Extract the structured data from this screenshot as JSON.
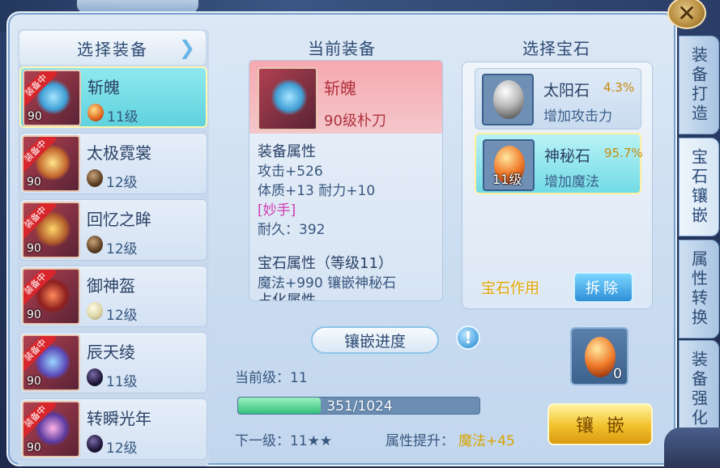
{
  "left": {
    "header": "选择装备",
    "items": [
      {
        "name": "斩魄",
        "level": "90",
        "tag": "装备中",
        "gem_level": "11级",
        "gem": "gem-orange"
      },
      {
        "name": "太极霓裳",
        "level": "90",
        "tag": "装备中",
        "gem_level": "12级",
        "gem": "gem-brown"
      },
      {
        "name": "回忆之眸",
        "level": "90",
        "tag": "装备中",
        "gem_level": "12级",
        "gem": "gem-brown"
      },
      {
        "name": "御神盔",
        "level": "90",
        "tag": "装备中",
        "gem_level": "12级",
        "gem": "gem-pale"
      },
      {
        "name": "辰天绫",
        "level": "90",
        "tag": "装备中",
        "gem_level": "11级",
        "gem": "gem-dark"
      },
      {
        "name": "转瞬光年",
        "level": "90",
        "tag": "装备中",
        "gem_level": "12级",
        "gem": "gem-dark"
      }
    ]
  },
  "current": {
    "title": "当前装备",
    "name": "斩魄",
    "subtitle": "90级朴刀",
    "attr_head": "装备属性",
    "attr_lines": [
      "攻击+526",
      "体质+13 耐力+10"
    ],
    "special": "[妙手]",
    "durability": "耐久：392",
    "gem_attr_head": "宝石属性（等级11）",
    "gem_attr_line": "魔法+990 镶嵌神秘石",
    "cut_line": "占化属性"
  },
  "gems": {
    "title": "选择宝石",
    "items": [
      {
        "name": "太阳石",
        "rate": "4.3%",
        "desc": "增加攻击力",
        "level": ""
      },
      {
        "name": "神秘石",
        "rate": "95.7%",
        "desc": "增加魔法",
        "level": "11级"
      }
    ],
    "effect_label": "宝石作用",
    "remove_label": "拆除"
  },
  "progress": {
    "title": "镶嵌进度",
    "help": "!",
    "current_level": "当前级：11",
    "bar_text": "351/1024",
    "bar_fraction": 0.343,
    "next_level": "下一级：11★★",
    "attr_up_label": "属性提升：",
    "attr_up_value": "魔法+45",
    "result_count": "0",
    "inlay_label": "镶嵌"
  },
  "tabs": [
    "装备打造",
    "宝石镶嵌",
    "属性转换",
    "装备强化"
  ],
  "close": "✕"
}
